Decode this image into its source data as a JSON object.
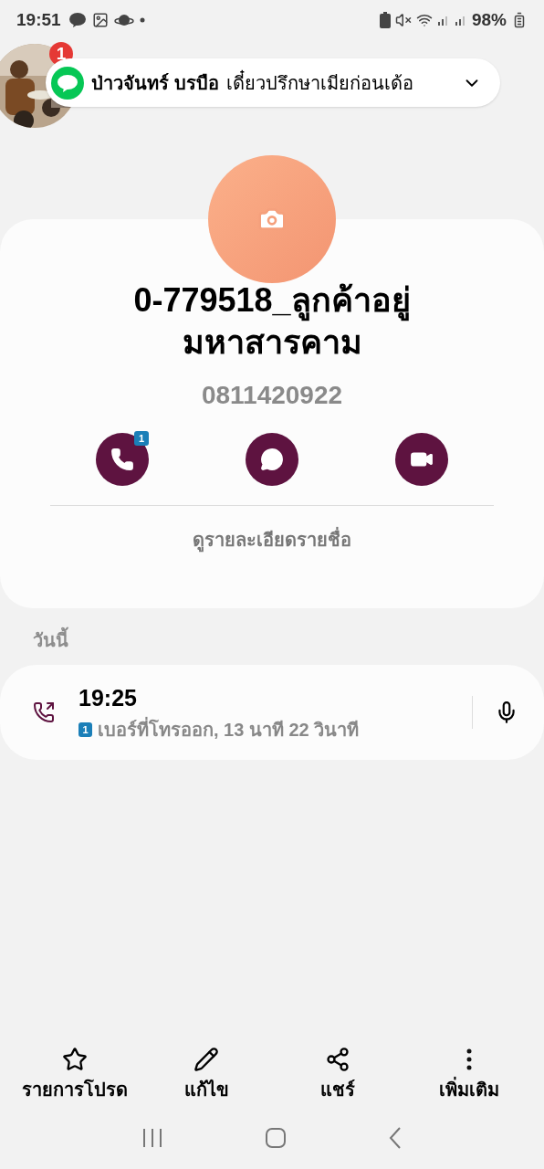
{
  "status_bar": {
    "time": "19:51",
    "battery": "98%"
  },
  "notification": {
    "badge": "1",
    "sender": "ป่าวจันทร์ บรบือ",
    "message": "เดี๋ยวปรึกษาเมียก่อนเด้อ"
  },
  "contact": {
    "name": "0-779518_ลูกค้าอยู่มหาสารคาม",
    "number": "0811420922",
    "actions": [
      {
        "kind": "call",
        "badge": "1"
      },
      {
        "kind": "message"
      },
      {
        "kind": "video"
      }
    ],
    "details_link": "ดูรายละเอียดรายชื่อ"
  },
  "history": {
    "heading": "วันนี้",
    "calls": [
      {
        "time": "19:25",
        "sim": "1",
        "description": "เบอร์ที่โทรออก, 13 นาที 22 วินาที"
      }
    ]
  },
  "bottom_actions": [
    {
      "kind": "favorite",
      "label": "รายการโปรด"
    },
    {
      "kind": "edit",
      "label": "แก้ไข"
    },
    {
      "kind": "share",
      "label": "แชร์"
    },
    {
      "kind": "more",
      "label": "เพิ่มเติม"
    }
  ]
}
